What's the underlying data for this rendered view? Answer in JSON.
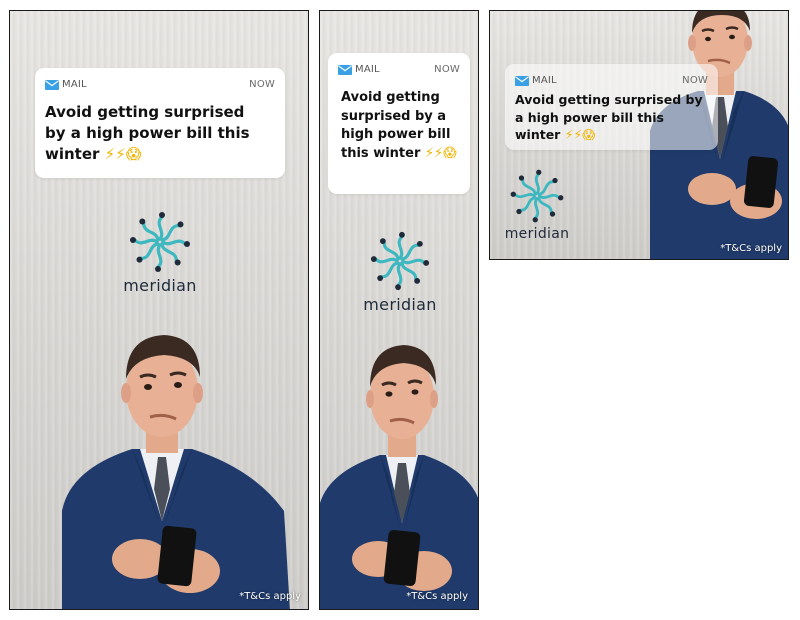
{
  "ads": [
    {
      "id": "ad-300x600",
      "notification": {
        "app": "MAIL",
        "time": "NOW",
        "message": "Avoid getting surprised by a high power bill this winter",
        "emoji": "⚡⚡😱"
      },
      "logo": "meridian",
      "disclaimer": "*T&Cs apply"
    },
    {
      "id": "ad-160x600",
      "notification": {
        "app": "MAIL",
        "time": "NOW",
        "message": "Avoid getting surprised by a high power bill this winter",
        "emoji": "⚡⚡😱"
      },
      "logo": "meridian",
      "disclaimer": "*T&Cs apply"
    },
    {
      "id": "ad-300x250",
      "notification": {
        "app": "MAIL",
        "time": "NOW",
        "message": "Avoid getting surprised by a high power bill this winter",
        "emoji": "⚡⚡😱"
      },
      "logo": "meridian",
      "disclaimer": "*T&Cs apply"
    }
  ],
  "icons": {
    "mail": "mail-icon",
    "logo": "meridian-logo-icon"
  },
  "colors": {
    "brand_teal": "#3db8c0",
    "brand_dark": "#1f2a3a",
    "suit_navy": "#1f3a6b",
    "mail_blue": "#3aa0e6"
  }
}
